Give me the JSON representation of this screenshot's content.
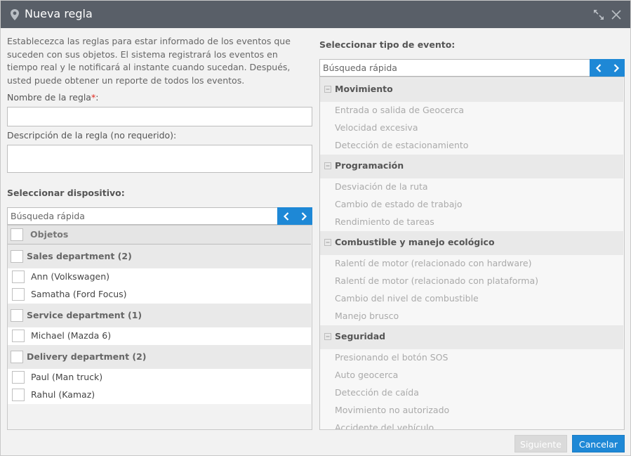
{
  "window": {
    "title": "Nueva regla"
  },
  "intro_text": "Establecezca las reglas para estar informado de los eventos que suceden con sus objetos. El sistema registrará los eventos en tiempo real y le notificará al instante cuando sucedan. Después, usted puede obtener un reporte de todos los eventos.",
  "rule_name": {
    "label": "Nombre de la regla",
    "required_mark": "*",
    "value": ""
  },
  "rule_description": {
    "label": "Descripción de la regla (no requerido):",
    "value": ""
  },
  "device_section": {
    "title": "Seleccionar dispositivo:",
    "search_placeholder": "Búsqueda rápida",
    "header_label": "Objetos",
    "groups": [
      {
        "label": "Sales department (2)",
        "items": [
          "Ann (Volkswagen)",
          "Samatha (Ford Focus)"
        ]
      },
      {
        "label": "Service department (1)",
        "items": [
          "Michael (Mazda 6)"
        ]
      },
      {
        "label": "Delivery department (2)",
        "items": [
          "Paul (Man truck)",
          "Rahul (Kamaz)"
        ]
      }
    ]
  },
  "event_section": {
    "title": "Seleccionar tipo de evento:",
    "search_placeholder": "Búsqueda rápida",
    "categories": [
      {
        "label": "Movimiento",
        "items": [
          "Entrada o salida de Geocerca",
          "Velocidad excesiva",
          "Detección de estacionamiento"
        ]
      },
      {
        "label": "Programación",
        "items": [
          "Desviación de la ruta",
          "Cambio de estado de trabajo",
          "Rendimiento de tareas"
        ]
      },
      {
        "label": "Combustible y manejo ecológico",
        "items": [
          "Ralentí de motor (relacionado con hardware)",
          "Ralentí de motor (relacionado con plataforma)",
          "Cambio del nivel de combustible",
          "Manejo brusco"
        ]
      },
      {
        "label": "Seguridad",
        "items": [
          "Presionando el botón SOS",
          "Auto geocerca",
          "Detección de caída",
          "Movimiento no autorizado",
          "Accidente del vehículo"
        ]
      }
    ]
  },
  "buttons": {
    "next": "Siguiente",
    "cancel": "Cancelar"
  },
  "colors": {
    "accent": "#1e88d6",
    "titlebar": "#595f68",
    "required": "#e2261c"
  },
  "icons": {
    "title": "map-pin-icon",
    "expand": "expand-icon",
    "close": "close-icon",
    "prev": "chevron-left-icon",
    "next": "chevron-right-icon",
    "collapse": "minus-icon"
  }
}
